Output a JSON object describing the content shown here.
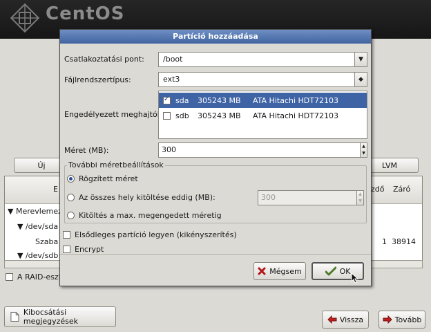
{
  "banner": {
    "brand": "CentOS"
  },
  "background": {
    "new_button": "Új",
    "lvm_button": "LVM",
    "tree": {
      "col_e": "E",
      "col_start": "zdő",
      "col_end": "Záró",
      "rows": [
        {
          "label": "Merevlemez",
          "prefix": "▼"
        },
        {
          "label": "/dev/sda",
          "prefix": "▼"
        },
        {
          "label": "Szaba",
          "prefix": ""
        },
        {
          "label": "/dev/sdb",
          "prefix": "▼"
        }
      ],
      "row3_start": "1",
      "row3_end": "38914"
    },
    "raid_label": "A RAID-eszk",
    "release_notes": "Kibocsátási megjegyzések",
    "back": "Vissza",
    "next": "Tovább"
  },
  "dialog": {
    "title": "Partíció hozzáadása",
    "mount_label": "Csatlakoztatási pont:",
    "mount_value": "/boot",
    "fs_label": "Fájlrendszertípus:",
    "fs_value": "ext3",
    "drives_label": "Engedélyezett meghajtók:",
    "drives": [
      {
        "name": "sda",
        "size": "305243 MB",
        "model": "ATA Hitachi HDT72103",
        "checked": true
      },
      {
        "name": "sdb",
        "size": "305243 MB",
        "model": "ATA Hitachi HDT72103",
        "checked": false
      }
    ],
    "size_label": "Méret (MB):",
    "size_value": "300",
    "more_options_title": "További méretbeállítások",
    "opt_fixed": "Rögzített méret",
    "opt_fill_upto": "Az összes hely kitöltése eddig (MB):",
    "fill_upto_value": "300",
    "opt_fill_max": "Kitöltés a max. megengedett méretig",
    "primary_label": "Elsődleges partíció legyen (kikényszerítés)",
    "encrypt_label": "Encrypt",
    "cancel": "Mégsem",
    "ok": "OK"
  },
  "colors": {
    "title_bar": "#41649f",
    "selection": "#3f64a6",
    "window_bg": "#dcdad5",
    "banner_bg": "#1e1e1e"
  },
  "icons": [
    "centos-logo-icon",
    "cancel-x-icon",
    "ok-check-icon",
    "back-arrow-icon",
    "next-arrow-icon",
    "release-notes-icon",
    "mouse-cursor-icon"
  ]
}
